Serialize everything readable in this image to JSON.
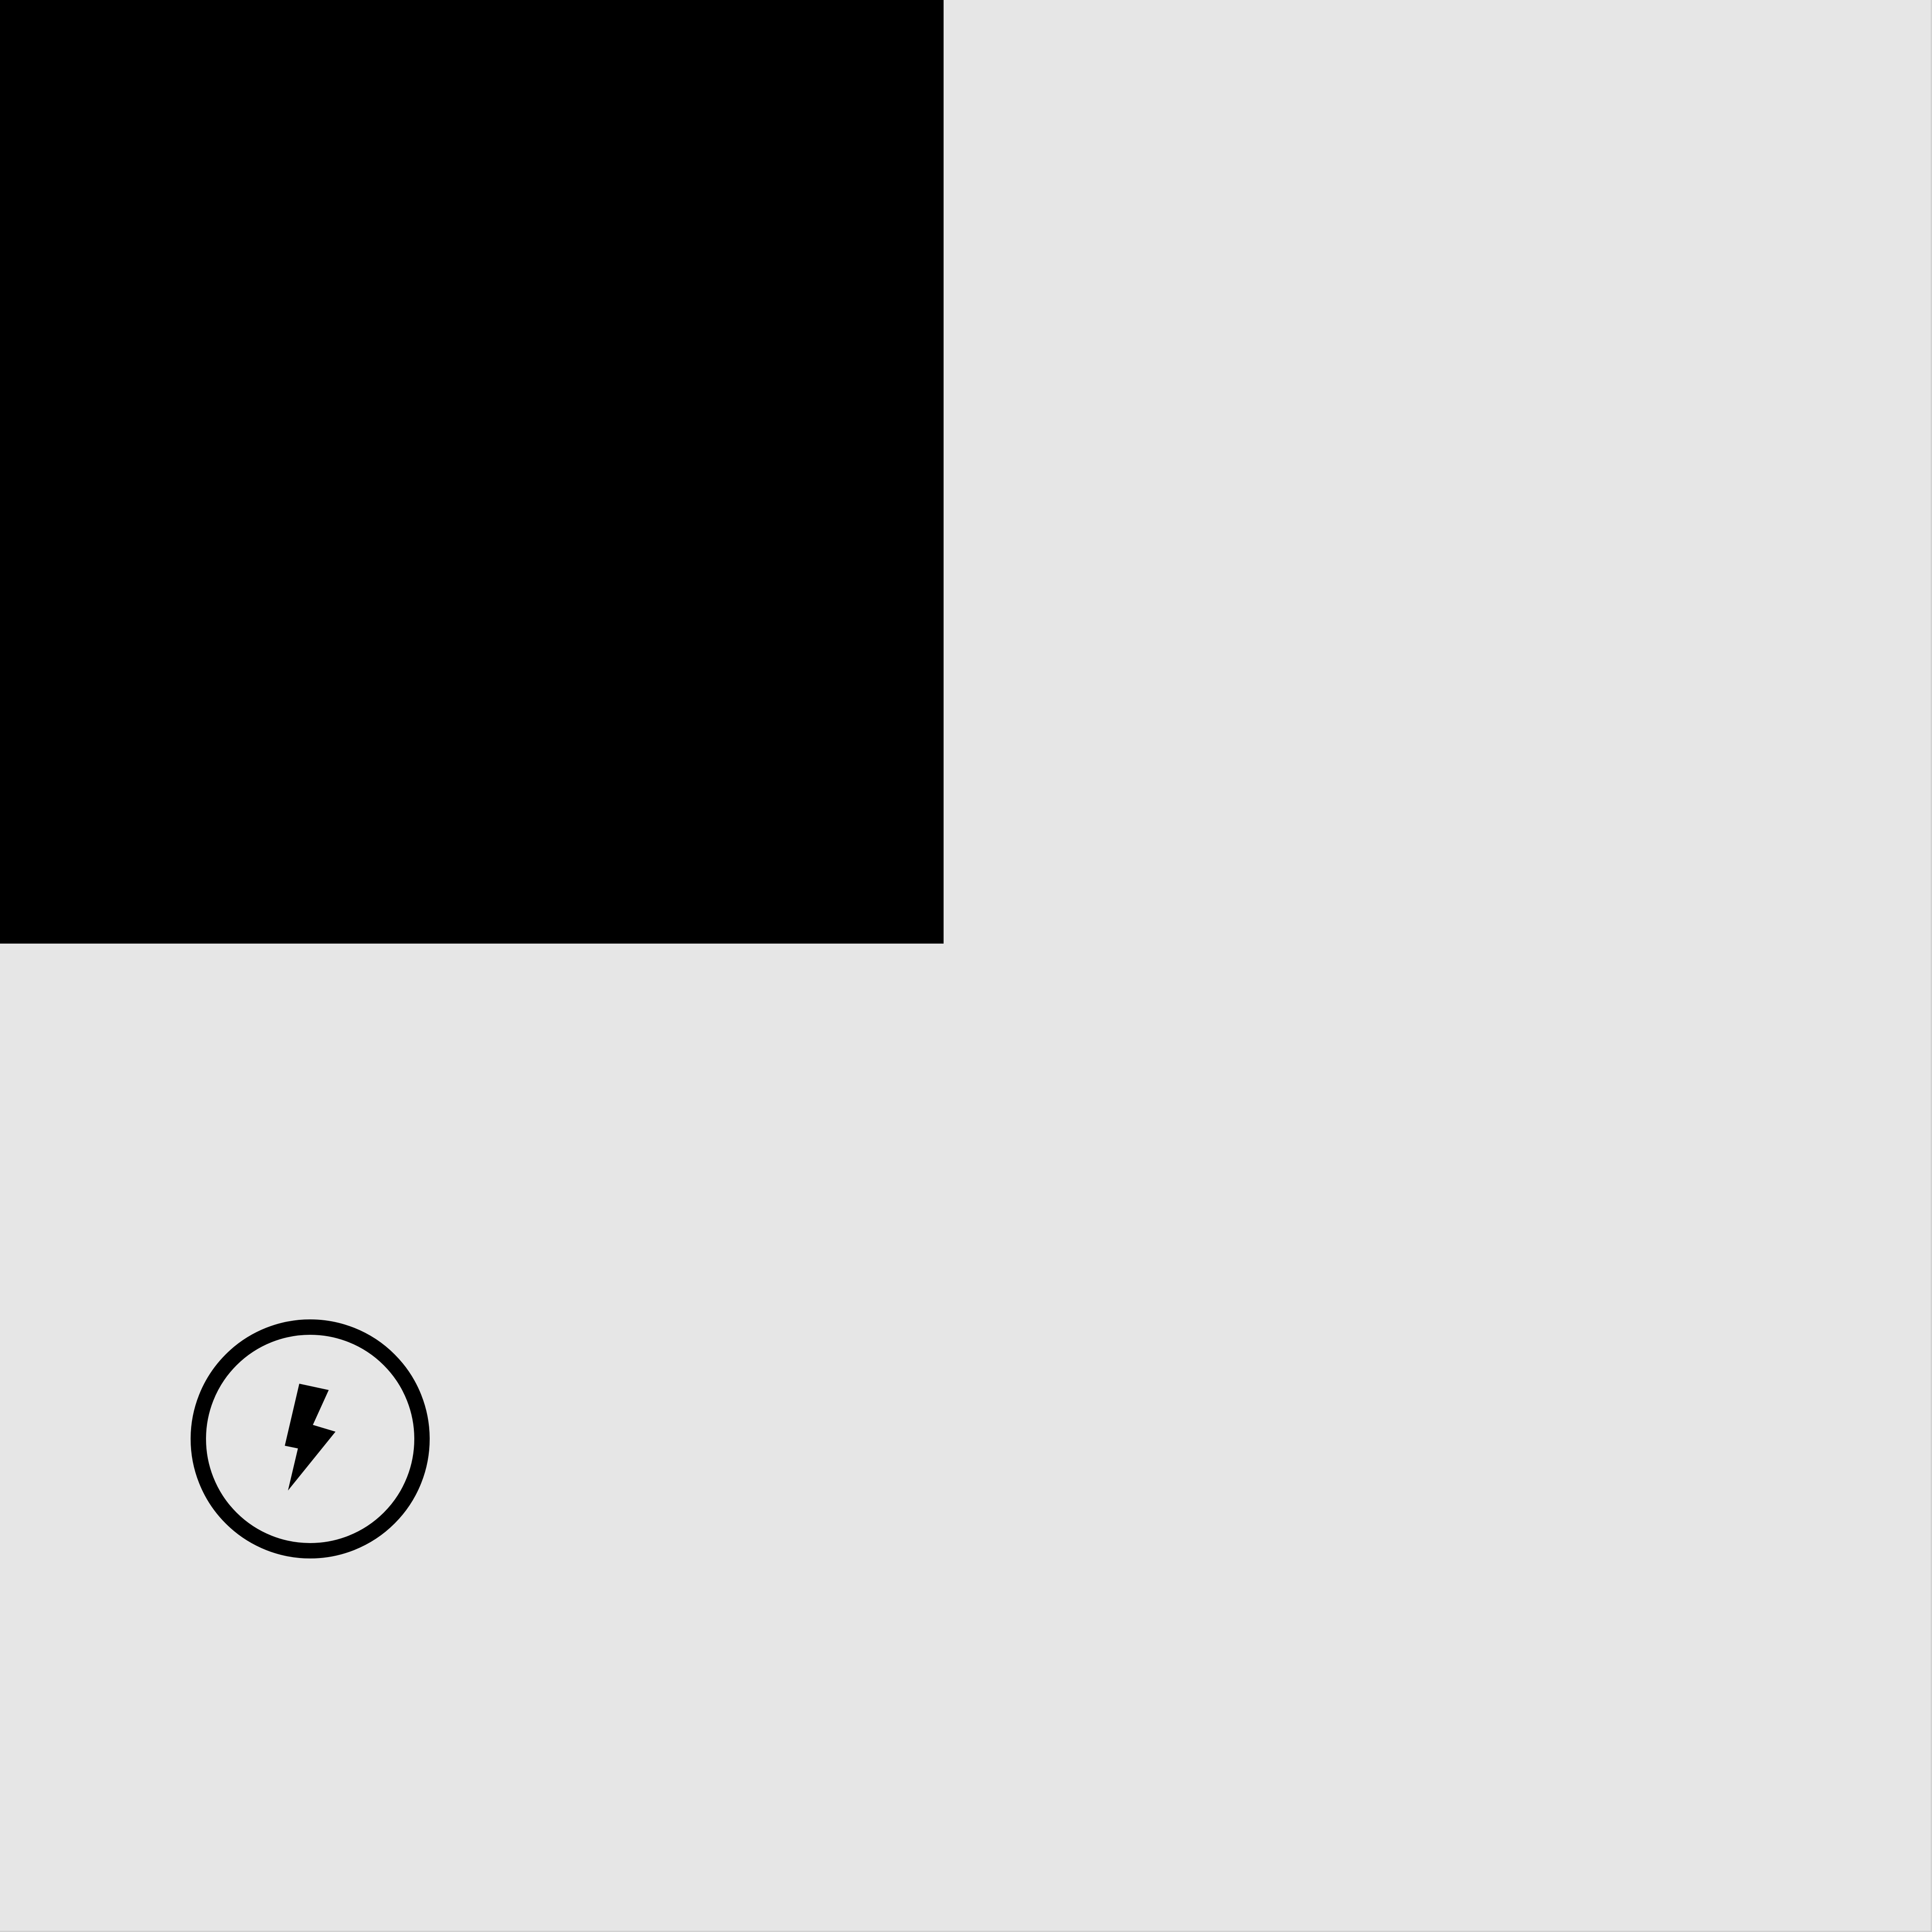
{
  "screen": {
    "background_color": "#e6e6e6",
    "preview_color": "#000000"
  },
  "camera_preview": {
    "state": "blank"
  },
  "controls": {
    "flash_button": {
      "icon": "lightning-bolt-icon",
      "border_color": "#000000",
      "icon_color": "#000000"
    }
  }
}
